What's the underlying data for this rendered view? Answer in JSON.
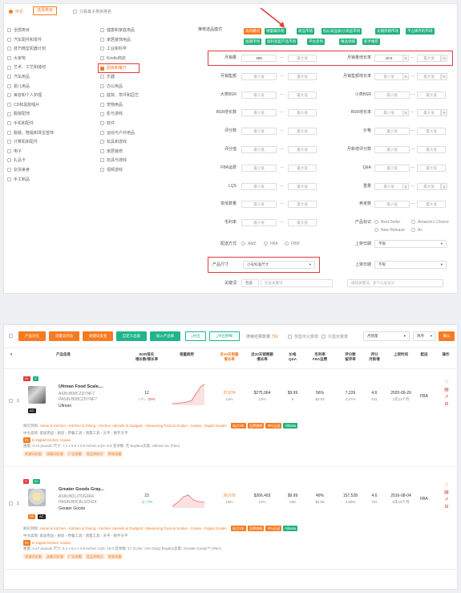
{
  "filters": {
    "lang_label": "中文",
    "select_category": "选择类目",
    "subcat_only": "只看最子类目排名",
    "categories_col1": [
      "全部类目",
      "汽车配件和零件",
      "技巧微型机器计划",
      "大家电",
      "艺术、工艺和缝纫",
      "汽车用品",
      "婴儿用品",
      "美容和个人护理",
      "CD和黑胶唱片",
      "服装配饰",
      "手机和配件",
      "服装、鞋履和珠宝首饰",
      "计算机和配件",
      "电子",
      "礼品卡",
      "杂货美食",
      "手工制品"
    ],
    "categories_col2": [
      "健康和家庭用品",
      "家居装饰用品",
      "工业和科学",
      "Kindle商店",
      "厨房和餐厅",
      "乐器",
      "办公用品",
      "庭院、草坪和园艺",
      "宠物用品",
      "影与游戏",
      "软件",
      "运动与户外用品",
      "玩具和游戏",
      "家居装修",
      "玩具与游戏",
      "视频游戏"
    ],
    "recommend_label": "推荐选品模式",
    "modes": [
      "高的模式",
      "销量飙升榜",
      "新品市场",
      "低价高品质/小高品市场",
      "长期热销市场",
      "不占库存的市场",
      "短期市场",
      "高利润型产品市场",
      "平台卖场",
      "精品领域",
      "新手推荐"
    ],
    "rows": [
      {
        "label": "月销量",
        "min": "300",
        "max": "最大值",
        "label2": "月销量增长率",
        "min2": "10.0",
        "max2": "最大值",
        "unit2": "%"
      },
      {
        "label": "月销售额",
        "min": "最小值",
        "max": "最大值",
        "label2": "月销售额增长率",
        "min2": "最小值",
        "max2": "最大值",
        "unit2": "%"
      },
      {
        "label": "大类BSR",
        "min": "最小值",
        "max": "最大值",
        "label2": "小类BSR",
        "min2": "最小值",
        "max2": "最大值",
        "unit2": ""
      },
      {
        "label": "BSR增长数",
        "min": "最小值",
        "max": "最大值",
        "label2": "BSR增长率",
        "min2": "最小值",
        "max2": "最大值",
        "unit2": "%"
      },
      {
        "label": "评分数",
        "min": "最小值",
        "max": "最大值",
        "label2": "价格",
        "min2": "最小值",
        "max2": "最大值",
        "unit2": ""
      },
      {
        "label": "评分值",
        "min": "最小值",
        "max": "最大值",
        "label2": "月新增评分数",
        "min2": "最小值",
        "max2": "最大值",
        "unit2": ""
      },
      {
        "label": "FBA运费",
        "min": "最小值",
        "max": "最大值",
        "label2": "Q&A",
        "min2": "最小值",
        "max2": "最大值",
        "unit2": ""
      },
      {
        "label": "LQS",
        "min": "最小值",
        "max": "最大值",
        "label2": "重量",
        "min2": "最小值",
        "max2": "最大值",
        "unit2": "g"
      },
      {
        "label": "变体数量",
        "min": "最小值",
        "max": "最大值",
        "label2": "卖家数",
        "min2": "最小值",
        "max2": "最大值",
        "unit2": ""
      },
      {
        "label": "毛利率",
        "min": "最小值",
        "max": "最大值",
        "label2": "产品标识",
        "min2": "",
        "max2": "",
        "unit2": ""
      }
    ],
    "product_flags": [
      "Best Seller",
      "Amazon's Choice",
      "New Release",
      "A+"
    ],
    "delivery_label": "配送方式",
    "delivery_opts": [
      "AMZ",
      "FBA",
      "FBM"
    ],
    "listing_date_label": "上架日期",
    "listing_date_value": "不限",
    "size_label": "产品尺寸",
    "size_value": "小号标准尺寸",
    "listing_label2": "上架日期",
    "listing_value2": "不限",
    "keyword_label": "关键词",
    "keyword_mode": "包含",
    "keyword_ph": "包含关键词",
    "exclude_ph": "排除关键词，多个以逗号分",
    "exclude_label": "排除"
  },
  "toolbar": {
    "buttons_orange": [
      "产品对比",
      "流量词对比",
      "关键词反查",
      "自定义品类",
      "加入产品库"
    ],
    "export": "导出",
    "export_all": "导出明细",
    "result_count_label": "搜索结果数量:",
    "result_count": "716",
    "only_parent": "仅显示父变体",
    "only_variant": "只显示变体",
    "sort_value": "月销量",
    "sort_dir": "降序",
    "confirm": "确认"
  },
  "table_headers": [
    "#",
    "产品信息",
    "BSR排名\n增长数/增长率",
    "销量趋势",
    "近30天销量\n增长率",
    "近30天销售额\n增长率",
    "价格\nQ&A",
    "毛利率\nFBA运费",
    "评分数\n留评率",
    "评分\n月新增",
    "上架时间",
    "配送",
    "操作"
  ],
  "products": [
    {
      "idx": "1",
      "title": "Ultrean Food Scale,...",
      "asin": "ASIN:B08CZDYNF7",
      "parent": "PASIN:B08CZDYNF7",
      "brand": "Ultrean",
      "bsr": "12",
      "bsr_change": "↓-7 ↓ -29%",
      "sales": "37,874",
      "sales_growth": "13%",
      "revenue": "$275,964",
      "revenue_growth": "13%",
      "price": "$9.99",
      "qa": "6",
      "margin": "56%",
      "fba": "$3.53",
      "ratings": "7,226",
      "review_rate": "2.27%",
      "score": "4.6",
      "score_new": "611",
      "date": "2020-09-29",
      "age": "1年11个月",
      "ship": "FBA",
      "category_path": "Home & Kitchen › Kitchen & Dining › Kitchen Utensils & Gadgets › Measuring Tools & Scales › Scales › Digital Scales",
      "cn_path": "中文类目: 家居用品 › 厨房 › 用餐工具 › 测量工具 › 天平 › 数字天平",
      "tag_text": "In Digital Kitchen Scales",
      "weight_line": "重量: 0.21 pounds    尺寸: 7.1 x 5.5 x 0.6 inches    LQS: 8.9    变体数: 无    BuyBox卖家: Ultrean Inc (FBA)",
      "tags2": [
        "关键词反查",
        "流量词反查",
        "广告流量",
        "竞品关联分",
        "关联流量"
      ]
    },
    {
      "idx": "2",
      "title": "Greater Goods Gray...",
      "asin": "ASIN:B01J7DG0R4",
      "parent": "PASIN:B0C8LSCN24",
      "brand": "Greater Goods",
      "bsr": "23",
      "bsr_change": "↑2 ↑7%",
      "sales": "26,676",
      "sales_growth": "13%",
      "revenue": "$266,493",
      "revenue_growth": "13%",
      "price": "$9.99",
      "qa": "500",
      "margin": "49%",
      "fba": "$3.58",
      "ratings": "157,528",
      "review_rate": "2.63%",
      "score": "4.6",
      "score_new": "701",
      "date": "2016-08-04",
      "age": "5年10个月",
      "ship": "FBA",
      "category_path": "Home & Kitchen › Kitchen & Dining › Kitchen Utensils & Gadgets › Measuring Tools & Scales › Scales › Digital Scales",
      "cn_path": "中文类目: 家居用品 › 厨房 › 用餐工具 › 测量工具 › 天平 › 数字天平",
      "tag_text": "In Digital Kitchen Scales",
      "weight_line": "重量: 0.47 pounds    尺寸: 8.1 x 6.1 x 0.6 inches    LQS: 10.0    变体数: 17 (Color: Ash Gray)    BuyBox卖家: Greater Goods™ (FBA)",
      "tags2": [
        "关键词反查",
        "流量词反查",
        "广告流量",
        "竞品关联分",
        "关联流量"
      ]
    }
  ],
  "badges": [
    "A+",
    "V",
    "AC",
    "A+",
    "V",
    "A+",
    "BS",
    "AC"
  ],
  "row_tags": [
    "站点1年",
    "品牌旗舰",
    "3PL运送",
    "Alibaba"
  ]
}
